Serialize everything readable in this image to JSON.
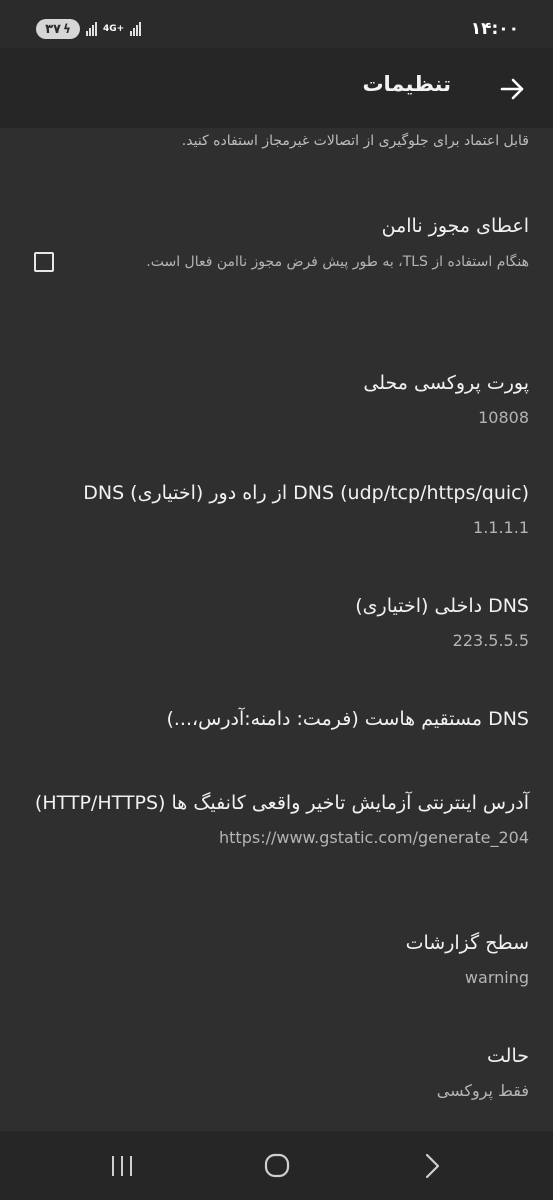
{
  "status_bar": {
    "time": "۱۴:۰۰",
    "battery_level": "۳۷",
    "network_type": "4G+"
  },
  "app_bar": {
    "title": "تنظیمات"
  },
  "partial_text": "قابل اعتماد برای جلوگیری از اتصالات غیرمجاز استفاده کنید.",
  "preferences": {
    "allow_insecure": {
      "title": "اعطای مجوز ناامن",
      "summary": "هنگام استفاده از TLS، به طور پیش فرض مجوز ناامن فعال است.",
      "checked": false
    },
    "local_proxy_port": {
      "title": "پورت پروکسی محلی",
      "value": "10808"
    },
    "remote_dns": {
      "title": "DNS (udp/tcp/https/quic) از راه دور (اختیاری) DNS",
      "value": "1.1.1.1"
    },
    "domestic_dns": {
      "title": "DNS داخلی (اختیاری)",
      "value": "223.5.5.5"
    },
    "dns_hosts": {
      "title": "DNS مستقیم هاست (فرمت: دامنه:آدرس،...)"
    },
    "delay_test_url": {
      "title": "آدرس اینترنتی آزمایش تاخیر واقعی کانفیگ ها (HTTP/HTTPS)",
      "value": "https://www.gstatic.com/generate_204"
    },
    "log_level": {
      "title": "سطح گزارشات",
      "value": "warning"
    },
    "mode": {
      "title": "حالت",
      "value": "فقط پروکسی"
    }
  }
}
